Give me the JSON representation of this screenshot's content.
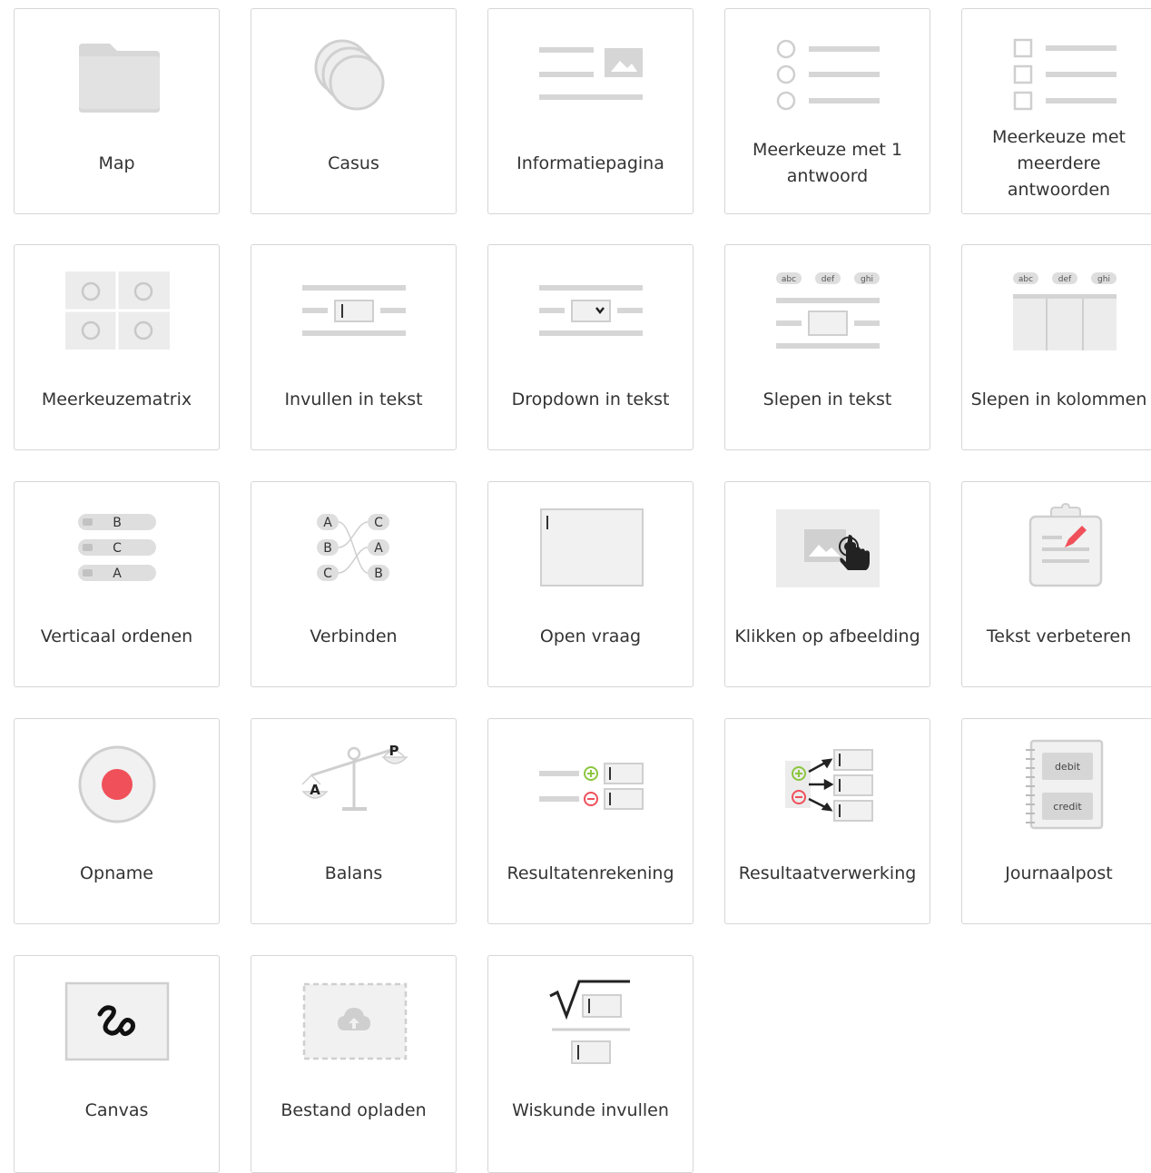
{
  "tiles": [
    {
      "id": "map",
      "label": "Map",
      "icon": "folder-icon"
    },
    {
      "id": "casus",
      "label": "Casus",
      "icon": "stacked-circles-icon"
    },
    {
      "id": "informatiepagina",
      "label": "Informatiepagina",
      "icon": "info-page-icon"
    },
    {
      "id": "meerkeuze-1",
      "label": "Meerkeuze met 1 antwoord",
      "icon": "radio-list-icon"
    },
    {
      "id": "meerkeuze-meerdere",
      "label": "Meerkeuze met meerdere antwoorden",
      "icon": "checkbox-list-icon"
    },
    {
      "id": "meerkeuzematrix",
      "label": "Meerkeuzematrix",
      "icon": "matrix-icon"
    },
    {
      "id": "invullen",
      "label": "Invullen in tekst",
      "icon": "fill-in-text-icon"
    },
    {
      "id": "dropdown",
      "label": "Dropdown in tekst",
      "icon": "dropdown-in-text-icon"
    },
    {
      "id": "slepen-tekst",
      "label": "Slepen in tekst",
      "icon": "drag-in-text-icon",
      "chips": [
        "abc",
        "def",
        "ghi"
      ]
    },
    {
      "id": "slepen-kolommen",
      "label": "Slepen in kolommen",
      "icon": "drag-in-columns-icon",
      "chips": [
        "abc",
        "def",
        "ghi"
      ]
    },
    {
      "id": "verticaal",
      "label": "Verticaal ordenen",
      "icon": "vertical-order-icon",
      "items": [
        "B",
        "C",
        "A"
      ]
    },
    {
      "id": "verbinden",
      "label": "Verbinden",
      "icon": "connect-icon",
      "left": [
        "A",
        "B",
        "C"
      ],
      "right": [
        "C",
        "A",
        "B"
      ]
    },
    {
      "id": "open-vraag",
      "label": "Open vraag",
      "icon": "open-question-icon"
    },
    {
      "id": "klikken",
      "label": "Klikken op afbeelding",
      "icon": "click-image-icon"
    },
    {
      "id": "tekst-verbeteren",
      "label": "Tekst verbeteren",
      "icon": "clipboard-edit-icon"
    },
    {
      "id": "opname",
      "label": "Opname",
      "icon": "record-icon"
    },
    {
      "id": "balans",
      "label": "Balans",
      "icon": "scale-icon",
      "letters": [
        "A",
        "P"
      ]
    },
    {
      "id": "resultatenrekening",
      "label": "Resultatenrekening",
      "icon": "income-statement-icon"
    },
    {
      "id": "resultaatverwerking",
      "label": "Resultaatverwerking",
      "icon": "result-processing-icon"
    },
    {
      "id": "journaalpost",
      "label": "Journaalpost",
      "icon": "journal-entry-icon",
      "entries": [
        "debit",
        "credit"
      ]
    },
    {
      "id": "canvas",
      "label": "Canvas",
      "icon": "canvas-drawing-icon"
    },
    {
      "id": "bestand",
      "label": "Bestand opladen",
      "icon": "file-upload-icon"
    },
    {
      "id": "wiskunde",
      "label": "Wiskunde invullen",
      "icon": "math-fill-in-icon"
    }
  ],
  "colors": {
    "icon_gray": "#dcdcdc",
    "line_gray": "#d0d0d0",
    "red": "#f0505a",
    "green": "#8cc63f",
    "text": "#333333"
  }
}
